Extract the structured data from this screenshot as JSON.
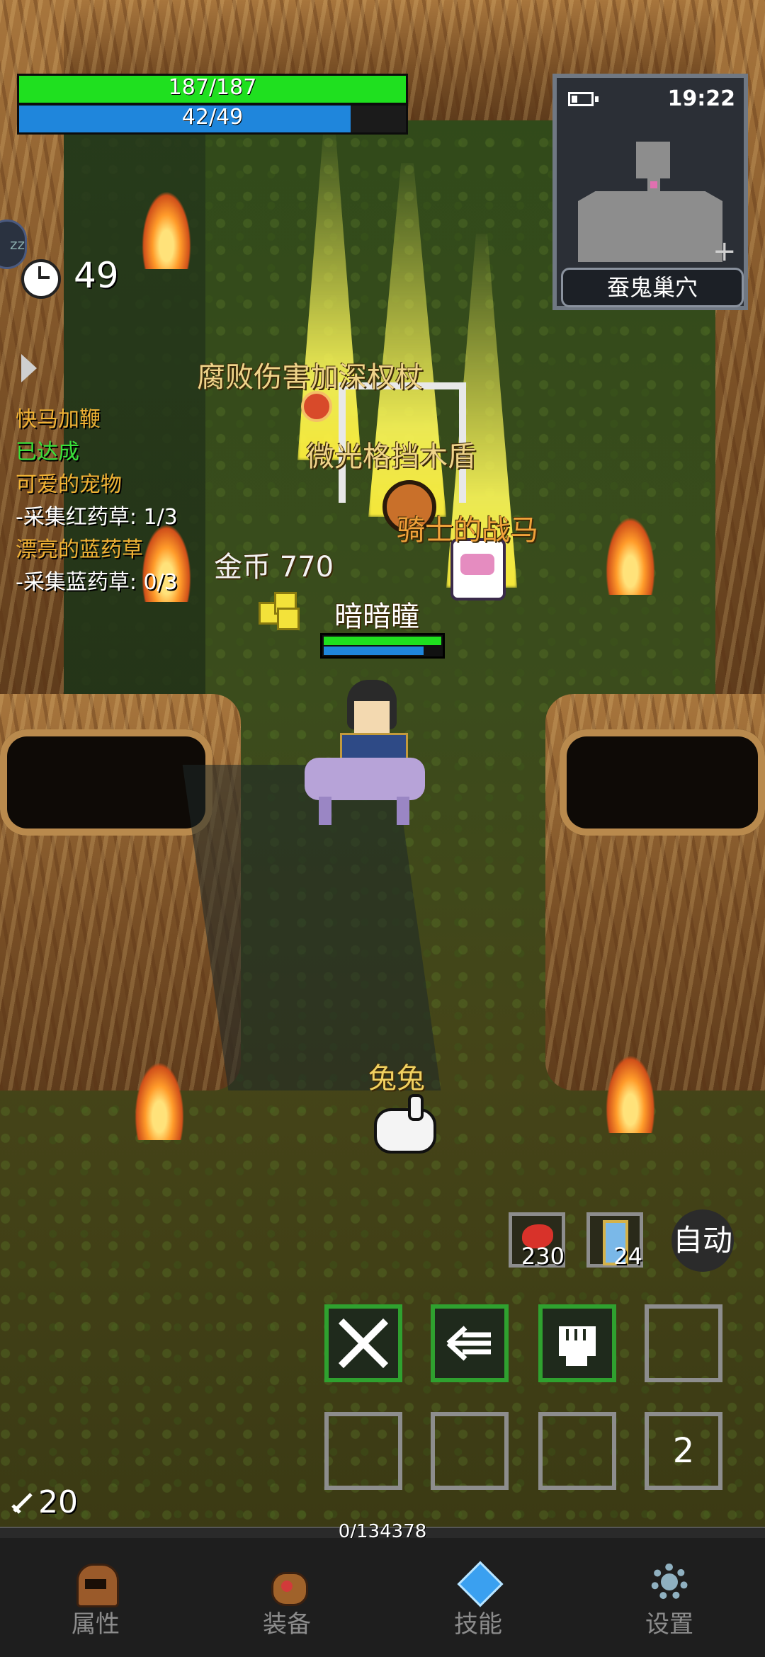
{
  "player": {
    "hp_text": "187/187",
    "hp_fraction": 1.0,
    "mp_text": "42/49",
    "mp_fraction": 0.857,
    "name": "暗暗瞳",
    "overhead_hp_fraction": 1.0,
    "overhead_mp_fraction": 0.85
  },
  "minimap": {
    "time": "19:22",
    "location": "蚕鬼巢穴",
    "add_symbol": "+"
  },
  "timer": {
    "value": "49"
  },
  "side_badge": "zz",
  "quests": {
    "q1_title": "快马加鞭",
    "q1_status": "已达成",
    "q2_title": "可爱的宠物",
    "q2_task": "-采集红药草: 1/3",
    "q3_title": "漂亮的蓝药草",
    "q3_task": "-采集蓝药草: 0/3"
  },
  "drops": {
    "item1": "腐败伤害加深权杖",
    "item2": "微光格挡木盾",
    "item3": "骑士的战马",
    "gold": "金币 770"
  },
  "pet": {
    "name": "兔兔"
  },
  "consumables": {
    "meat_count": "230",
    "scroll_count": "24",
    "auto_label": "自动"
  },
  "skill_bar": {
    "page_number": "2"
  },
  "attack_stat": "20",
  "exp": {
    "text": "0/134378",
    "fraction": 0.0
  },
  "bottom_nav": [
    {
      "label": "属性",
      "icon": "helmet-icon"
    },
    {
      "label": "装备",
      "icon": "bag-icon"
    },
    {
      "label": "技能",
      "icon": "crystal-icon"
    },
    {
      "label": "设置",
      "icon": "gear-icon"
    }
  ],
  "colors": {
    "hp": "#1fe01f",
    "mp": "#1f86dc",
    "quest_title": "#f0b235",
    "quest_done": "#3ae03a",
    "skill_border": "#2fa12f"
  }
}
